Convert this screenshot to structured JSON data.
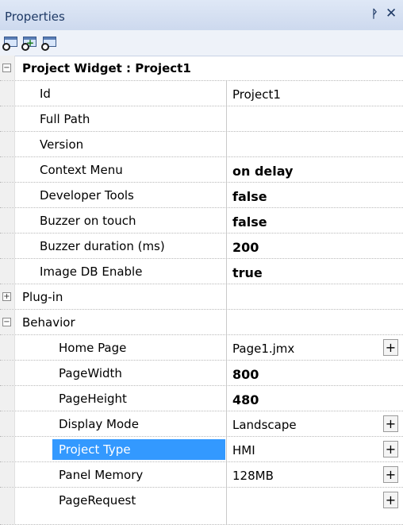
{
  "panel": {
    "title": "Properties",
    "pin_icon": "pin-icon",
    "close_icon": "close-icon",
    "pin_glyph": "ᚹ",
    "close_glyph": "✕"
  },
  "toolbar": {
    "buttons": [
      "properties-view-icon",
      "add-property-icon",
      "edit-property-icon"
    ]
  },
  "category": {
    "label": "Project Widget : Project1",
    "expander": "⊟"
  },
  "rows": [
    {
      "name": "Id",
      "value": "Project1"
    },
    {
      "name": "Full Path",
      "value": ""
    },
    {
      "name": "Version",
      "value": ""
    },
    {
      "name": "Context Menu",
      "value": "on delay"
    },
    {
      "name": "Developer Tools",
      "value": "false"
    },
    {
      "name": "Buzzer on touch",
      "value": "false"
    },
    {
      "name": "Buzzer duration (ms)",
      "value": "200"
    },
    {
      "name": "Image DB Enable",
      "value": "true"
    }
  ],
  "groups": {
    "plugin": {
      "label": "Plug-in",
      "expander": "+"
    },
    "behavior": {
      "label": "Behavior",
      "expander": "−"
    }
  },
  "behavior_rows": [
    {
      "name": "Home Page",
      "value": "Page1.jmx",
      "button": "+"
    },
    {
      "name": "PageWidth",
      "value": "800"
    },
    {
      "name": "PageHeight",
      "value": "480"
    },
    {
      "name": "Display Mode",
      "value": "Landscape",
      "button": "+"
    },
    {
      "name": "Project Type",
      "value": "HMI",
      "button": "+"
    },
    {
      "name": "Panel Memory",
      "value": "128MB",
      "button": "+"
    },
    {
      "name": "PageRequest",
      "value": "",
      "button": "+"
    }
  ]
}
